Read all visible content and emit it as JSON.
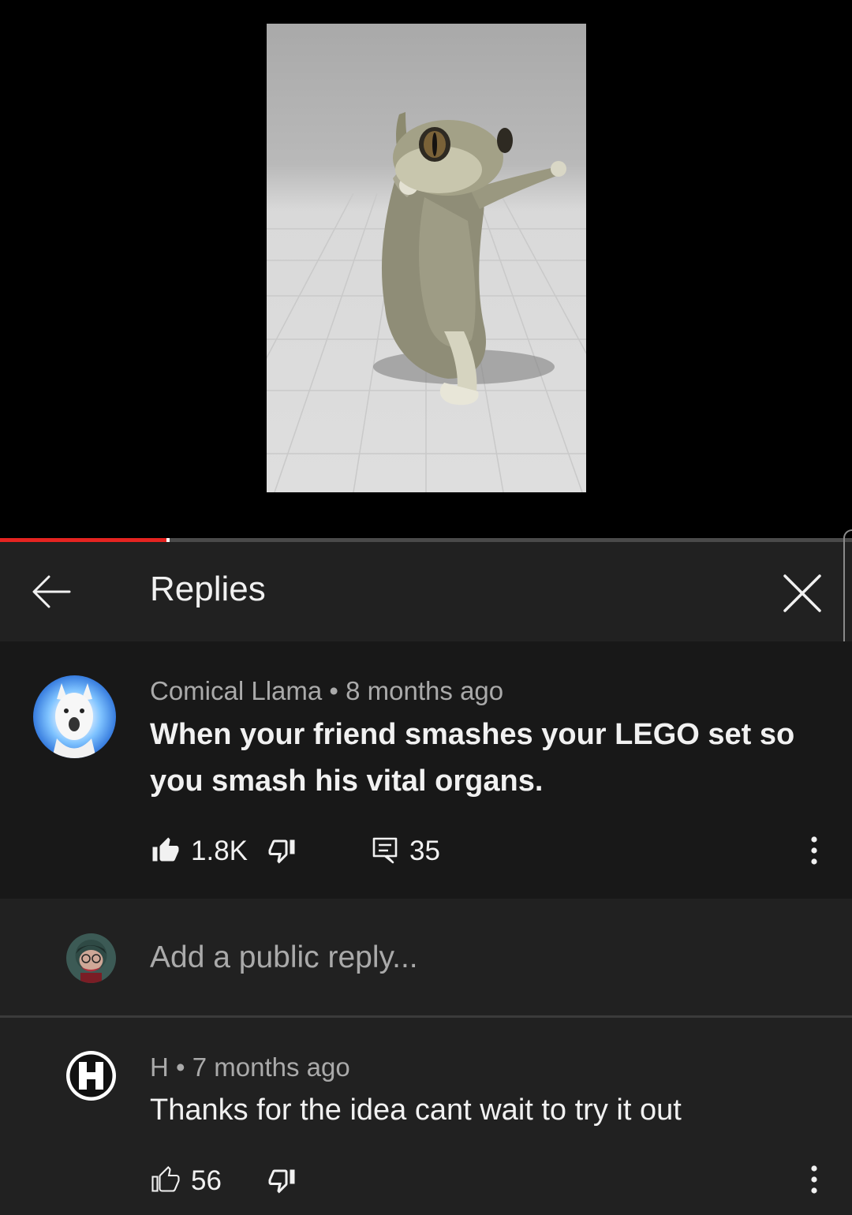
{
  "video": {
    "progress_fraction": 0.195
  },
  "panel": {
    "title": "Replies"
  },
  "comment": {
    "author": "Comical Llama",
    "time": "8 months ago",
    "text": "When your friend smashes your LEGO set so you smash his vital organs.",
    "likes": "1.8K",
    "reply_count": "35"
  },
  "reply_input": {
    "placeholder": "Add a public reply..."
  },
  "reply": {
    "author": "H",
    "time": "7 months ago",
    "text": "Thanks for the idea cant wait to try it out",
    "likes": "56",
    "avatar_letter": "H"
  },
  "colors": {
    "progress": "#e52421",
    "panel_bg": "#212121",
    "highlight_bg": "#181818",
    "secondary_text": "#aaaaaa"
  }
}
